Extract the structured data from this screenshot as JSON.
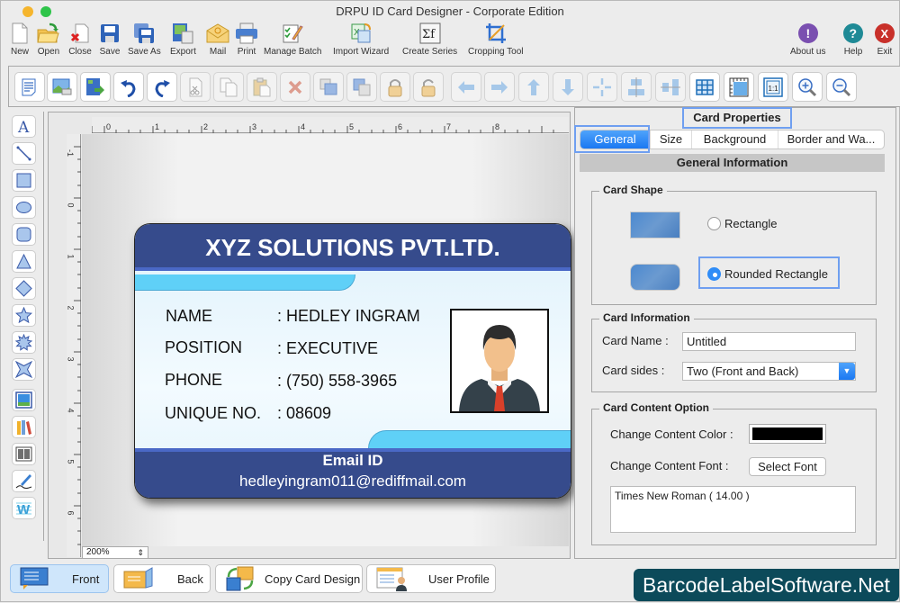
{
  "window": {
    "title": "DRPU ID Card Designer - Corporate Edition",
    "traffic_lights": [
      "#f5b52d",
      "#2ec44a"
    ]
  },
  "main_toolbar": [
    {
      "label": "New",
      "icon": "new-document-icon"
    },
    {
      "label": "Open",
      "icon": "open-folder-icon"
    },
    {
      "label": "Close",
      "icon": "close-document-icon"
    },
    {
      "label": "Save",
      "icon": "save-icon"
    },
    {
      "label": "Save As",
      "icon": "save-as-icon"
    },
    {
      "label": "Export",
      "icon": "export-icon"
    },
    {
      "label": "Mail",
      "icon": "mail-icon"
    },
    {
      "label": "Print",
      "icon": "print-icon"
    },
    {
      "label": "Manage Batch",
      "icon": "manage-batch-icon"
    },
    {
      "label": "Import Wizard",
      "icon": "import-wizard-icon"
    },
    {
      "label": "Create Series",
      "icon": "create-series-icon"
    },
    {
      "label": "Cropping Tool",
      "icon": "crop-icon"
    }
  ],
  "right_toolbar": [
    {
      "label": "About us",
      "icon": "about-icon",
      "color": "#7a4fb0",
      "glyph": "!"
    },
    {
      "label": "Help",
      "icon": "help-icon",
      "color": "#1f8a96",
      "glyph": "?"
    },
    {
      "label": "Exit",
      "icon": "exit-icon",
      "color": "#c8302a",
      "glyph": "X"
    }
  ],
  "icon_toolbar": [
    {
      "name": "properties",
      "enabled": true
    },
    {
      "name": "image-properties",
      "enabled": true
    },
    {
      "name": "export-image",
      "enabled": true
    },
    {
      "name": "undo",
      "enabled": true
    },
    {
      "name": "redo",
      "enabled": true
    },
    {
      "name": "cut",
      "enabled": false
    },
    {
      "name": "copy",
      "enabled": false
    },
    {
      "name": "paste",
      "enabled": false
    },
    {
      "name": "delete",
      "enabled": false
    },
    {
      "name": "bring-to-front",
      "enabled": false
    },
    {
      "name": "send-to-back",
      "enabled": false
    },
    {
      "name": "lock",
      "enabled": false
    },
    {
      "name": "unlock",
      "enabled": false
    },
    {
      "name": "move-left",
      "enabled": false
    },
    {
      "name": "move-right",
      "enabled": false
    },
    {
      "name": "move-up",
      "enabled": false
    },
    {
      "name": "move-down",
      "enabled": false
    },
    {
      "name": "center",
      "enabled": false
    },
    {
      "name": "align-horizontal",
      "enabled": false
    },
    {
      "name": "align-vertical",
      "enabled": false
    },
    {
      "name": "grid",
      "enabled": true
    },
    {
      "name": "ruler",
      "enabled": true
    },
    {
      "name": "actual-size",
      "enabled": true
    },
    {
      "name": "zoom-in",
      "enabled": true
    },
    {
      "name": "zoom-out",
      "enabled": true
    }
  ],
  "left_tools": [
    "text",
    "line",
    "rectangle",
    "ellipse",
    "rounded-rectangle",
    "triangle",
    "diamond",
    "star",
    "burst",
    "four-point-star",
    "picture",
    "library",
    "barcode",
    "signature",
    "watermark"
  ],
  "rulers": {
    "horizontal": [
      "0",
      "1",
      "2",
      "3",
      "4",
      "5",
      "6",
      "7",
      "8"
    ],
    "vertical": [
      "-1",
      "0",
      "1",
      "2",
      "3",
      "4",
      "5",
      "6"
    ]
  },
  "canvas": {
    "zoom": "200%"
  },
  "card": {
    "company": "XYZ SOLUTIONS PVT.LTD.",
    "fields": [
      {
        "label": "NAME",
        "value": ": HEDLEY INGRAM"
      },
      {
        "label": "POSITION",
        "value": ": EXECUTIVE"
      },
      {
        "label": "PHONE",
        "value": ": (750) 558-3965"
      },
      {
        "label": "UNIQUE NO.",
        "value": ": 08609"
      }
    ],
    "email_label": "Email ID",
    "email": "hedleyingram011@rediffmail.com",
    "header_color": "#364b8c",
    "accent_color": "#5fd0f7"
  },
  "properties": {
    "title": "Card Properties",
    "tabs": [
      "General",
      "Size",
      "Background",
      "Border and Wa..."
    ],
    "active_tab": "General",
    "section_heading": "General Information",
    "card_shape": {
      "title": "Card Shape",
      "options": [
        "Rectangle",
        "Rounded Rectangle"
      ],
      "selected": "Rounded Rectangle"
    },
    "card_information": {
      "title": "Card Information",
      "name_label": "Card Name :",
      "name_value": "Untitled",
      "sides_label": "Card sides :",
      "sides_value": "Two (Front and Back)"
    },
    "content_option": {
      "title": "Card Content Option",
      "color_label": "Change Content Color :",
      "color_value": "#000000",
      "font_label": "Change Content Font :",
      "font_button": "Select Font",
      "font_value": "Times New Roman ( 14.00 )"
    }
  },
  "bottom_bar": [
    {
      "label": "Front",
      "icon": "front-card-icon",
      "active": true
    },
    {
      "label": "Back",
      "icon": "back-card-icon",
      "active": false
    },
    {
      "label": "Copy Card Design",
      "icon": "copy-design-icon",
      "active": false
    },
    {
      "label": "User Profile",
      "icon": "user-profile-icon",
      "active": false
    }
  ],
  "watermark": "BarcodeLabelSoftware.Net"
}
